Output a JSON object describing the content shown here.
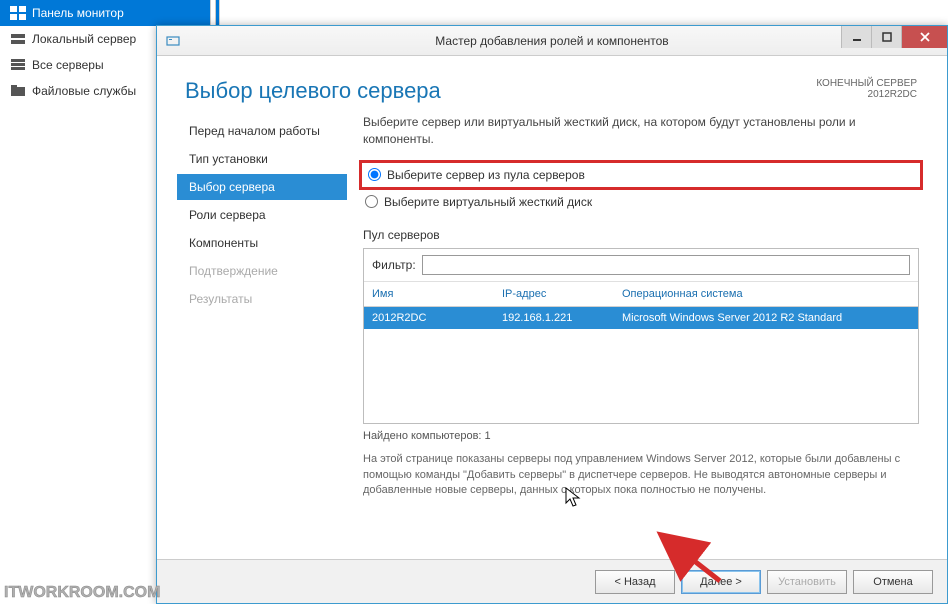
{
  "background": {
    "items": [
      {
        "label": "Панель монитор",
        "active": true
      },
      {
        "label": "Локальный сервер",
        "active": false
      },
      {
        "label": "Все серверы",
        "active": false
      },
      {
        "label": "Файловые службы",
        "active": false
      }
    ]
  },
  "dialog": {
    "title": "Мастер добавления ролей и компонентов",
    "page_title": "Выбор целевого сервера",
    "header_right_line1": "КОНЕЧНЫЙ СЕРВЕР",
    "header_right_line2": "2012R2DC",
    "nav": [
      {
        "label": "Перед началом работы",
        "state": "normal"
      },
      {
        "label": "Тип установки",
        "state": "normal"
      },
      {
        "label": "Выбор сервера",
        "state": "active"
      },
      {
        "label": "Роли сервера",
        "state": "normal"
      },
      {
        "label": "Компоненты",
        "state": "normal"
      },
      {
        "label": "Подтверждение",
        "state": "disabled"
      },
      {
        "label": "Результаты",
        "state": "disabled"
      }
    ],
    "instruction": "Выберите сервер или виртуальный жесткий диск, на котором будут установлены роли и компоненты.",
    "radio": {
      "option1": "Выберите сервер из пула серверов",
      "option2": "Выберите виртуальный жесткий диск"
    },
    "pool": {
      "header": "Пул серверов",
      "filter_label": "Фильтр:",
      "filter_value": "",
      "columns": {
        "name": "Имя",
        "ip": "IP-адрес",
        "os": "Операционная система"
      },
      "rows": [
        {
          "name": "2012R2DC",
          "ip": "192.168.1.221",
          "os": "Microsoft Windows Server 2012 R2 Standard"
        }
      ],
      "found": "Найдено компьютеров: 1"
    },
    "description": "На этой странице показаны серверы под управлением Windows Server 2012, которые были добавлены с помощью команды \"Добавить серверы\" в диспетчере серверов. Не выводятся автономные серверы и добавленные новые серверы, данных с которых пока полностью не получены.",
    "buttons": {
      "back": "< Назад",
      "next": "Далее >",
      "install": "Установить",
      "cancel": "Отмена"
    }
  },
  "watermark": "ITWORKROOM.COM"
}
